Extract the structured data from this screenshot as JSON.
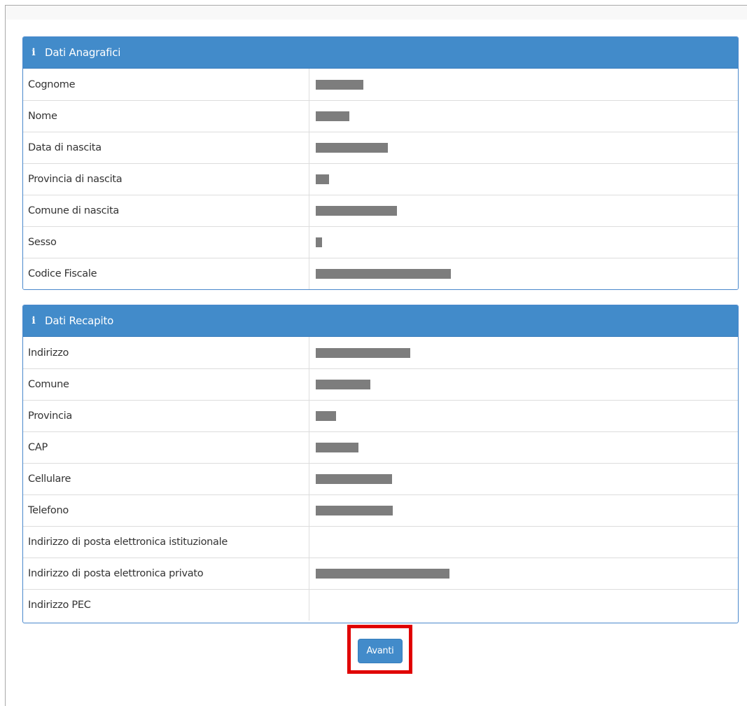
{
  "sections": {
    "anagrafici": {
      "title": "Dati Anagrafici",
      "icon": "info-icon",
      "rows": [
        {
          "label": "Cognome",
          "redacted": true
        },
        {
          "label": "Nome",
          "redacted": true
        },
        {
          "label": "Data di nascita",
          "redacted": true
        },
        {
          "label": "Provincia di nascita",
          "redacted": true
        },
        {
          "label": "Comune di nascita",
          "redacted": true
        },
        {
          "label": "Sesso",
          "redacted": true
        },
        {
          "label": "Codice Fiscale",
          "redacted": true
        }
      ]
    },
    "recapito": {
      "title": "Dati Recapito",
      "icon": "info-icon",
      "rows": [
        {
          "label": "Indirizzo",
          "redacted": true
        },
        {
          "label": "Comune",
          "redacted": true
        },
        {
          "label": "Provincia",
          "redacted": true
        },
        {
          "label": "CAP",
          "redacted": true
        },
        {
          "label": "Cellulare",
          "redacted": true
        },
        {
          "label": "Telefono",
          "redacted": true
        },
        {
          "label": "Indirizzo di posta elettronica istituzionale",
          "redacted": false
        },
        {
          "label": "Indirizzo di posta elettronica privato",
          "redacted": true
        },
        {
          "label": "Indirizzo PEC",
          "redacted": false
        }
      ]
    }
  },
  "actions": {
    "next_label": "Avanti"
  },
  "colors": {
    "panel_header": "#428bca",
    "button": "#428bca",
    "highlight_border": "#e00000",
    "redaction": "#7d7d7d"
  }
}
